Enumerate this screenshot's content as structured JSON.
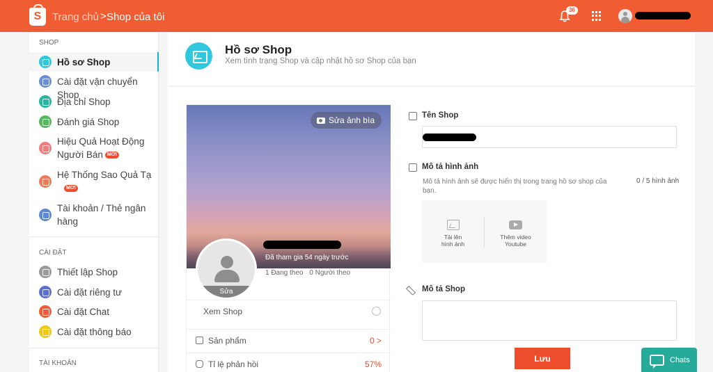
{
  "header": {
    "breadcrumb_home": "Trang chủ",
    "breadcrumb_sep": ">",
    "breadcrumb_current": "Shop của tôi",
    "notification_count": "36",
    "brand_color": "#f05d32"
  },
  "sidebar": {
    "section_shop": "SHOP",
    "section_settings": "CÀI ĐẶT",
    "section_account": "TÀI KHOẢN",
    "new_badge": "MỚI",
    "shop_items": [
      {
        "label": "Hồ sơ Shop",
        "icon": "profile-icon",
        "color": "#31c7dc"
      },
      {
        "label": "Cài đặt vận chuyển Shop",
        "icon": "truck-icon",
        "color": "#6b8fd6"
      },
      {
        "label": "Địa chỉ Shop",
        "icon": "location-icon",
        "color": "#26b7a0"
      },
      {
        "label": "Đánh giá Shop",
        "icon": "star-icon",
        "color": "#56b85c"
      },
      {
        "label": "Hiệu Quả Hoạt Động Người Bán",
        "icon": "chart-icon",
        "color": "#f37b7b"
      },
      {
        "label": "Hệ Thống Sao Quả Tạ",
        "icon": "lightning-icon",
        "color": "#f07a55"
      },
      {
        "label": "Tài khoản / Thẻ ngân hàng",
        "icon": "card-icon",
        "color": "#5d8ad6"
      }
    ],
    "settings_items": [
      {
        "label": "Thiết lập Shop",
        "icon": "gear-icon",
        "color": "#9a9a9a"
      },
      {
        "label": "Cài đặt riêng tư",
        "icon": "lock-icon",
        "color": "#5a6fd1"
      },
      {
        "label": "Cài đặt Chat",
        "icon": "chat-icon",
        "color": "#f05d32"
      },
      {
        "label": "Cài đặt thông báo",
        "icon": "bell-icon",
        "color": "#f5c518"
      }
    ]
  },
  "main": {
    "title": "Hồ sơ Shop",
    "subtitle": "Xem tình trạng Shop và cập nhật hồ sơ Shop của bạn"
  },
  "card": {
    "edit_cover": "Sửa ảnh bìa",
    "avatar_edit": "Sửa",
    "joined": "Đã tham gia 54 ngày trước",
    "following": "1 Đang theo",
    "followers": "0 Người theo",
    "view_shop": "Xem Shop",
    "products_label": "Sản phẩm",
    "products_value": "0",
    "products_arrow": ">",
    "response_label": "Tỉ lệ phản hồi",
    "response_value": "57%"
  },
  "form": {
    "shop_name_label": "Tên Shop",
    "media_label": "Mô tả hình ảnh",
    "media_hint": "Mô tả hình ảnh sẽ được hiển thị trong trang hồ sơ shop của bạn.",
    "media_count": "0 / 5 hình ảnh",
    "upload_image": "Tải lên hình ảnh",
    "add_video": "Thêm video Youtube",
    "description_label": "Mô tả Shop",
    "save_button": "Lưu"
  },
  "chat": {
    "label": "Chats",
    "color": "#26aa99"
  }
}
